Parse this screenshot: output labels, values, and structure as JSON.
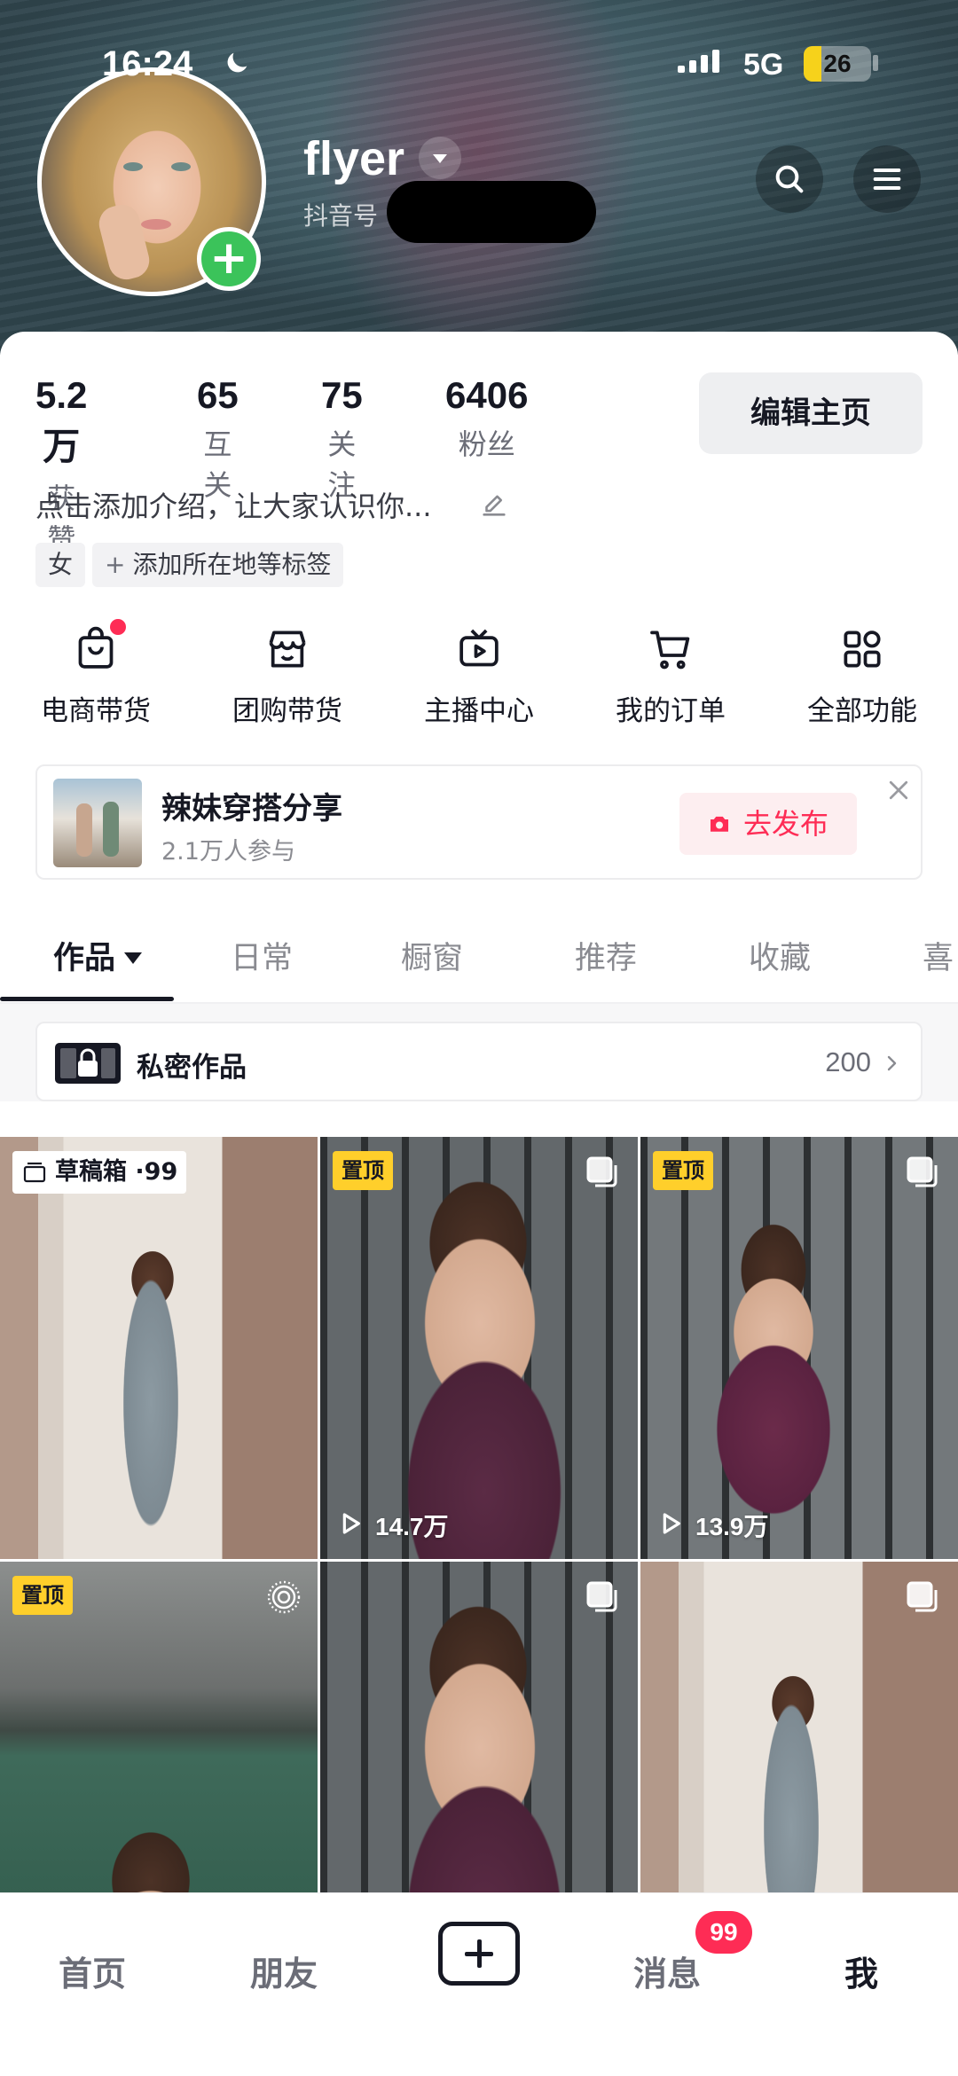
{
  "status_bar": {
    "time": "16:24",
    "network": "5G",
    "battery": "26",
    "battery_level": 0.26
  },
  "profile": {
    "username": "flyer",
    "id_label": "抖音号",
    "stats": [
      {
        "value": "5.2万",
        "label": "获赞"
      },
      {
        "value": "65",
        "label": "互关"
      },
      {
        "value": "75",
        "label": "关注"
      },
      {
        "value": "6406",
        "label": "粉丝"
      }
    ],
    "edit_button": "编辑主页",
    "bio": "点击添加介绍，让大家认识你...",
    "tags": {
      "gender": "女",
      "add_location": "添加所在地等标签",
      "add_prefix": "+"
    }
  },
  "features": [
    {
      "label": "电商带货",
      "icon": "shopping-bag-icon"
    },
    {
      "label": "团购带货",
      "icon": "store-icon"
    },
    {
      "label": "主播中心",
      "icon": "tv-play-icon"
    },
    {
      "label": "我的订单",
      "icon": "cart-icon"
    },
    {
      "label": "全部功能",
      "icon": "grid-apps-icon"
    }
  ],
  "promo": {
    "title": "辣妹穿搭分享",
    "subtitle": "2.1万人参与",
    "button": "去发布"
  },
  "tabs": [
    "作品",
    "日常",
    "橱窗",
    "推荐",
    "收藏",
    "喜"
  ],
  "private_works": {
    "label": "私密作品",
    "count": "200"
  },
  "grid": {
    "draft_label": "草稿箱 ·99",
    "pinned_label": "置顶",
    "tiles": [
      {
        "views": ""
      },
      {
        "views": "14.7万"
      },
      {
        "views": "13.9万"
      },
      {
        "views": ""
      },
      {
        "views": ""
      },
      {
        "views": ""
      }
    ]
  },
  "bottom_nav": {
    "home": "首页",
    "friends": "朋友",
    "messages": "消息",
    "messages_badge": "99",
    "me": "我"
  },
  "colors": {
    "accent": "#fe2c55",
    "pinned": "#ffcf2b",
    "add_green": "#3bc35a"
  }
}
